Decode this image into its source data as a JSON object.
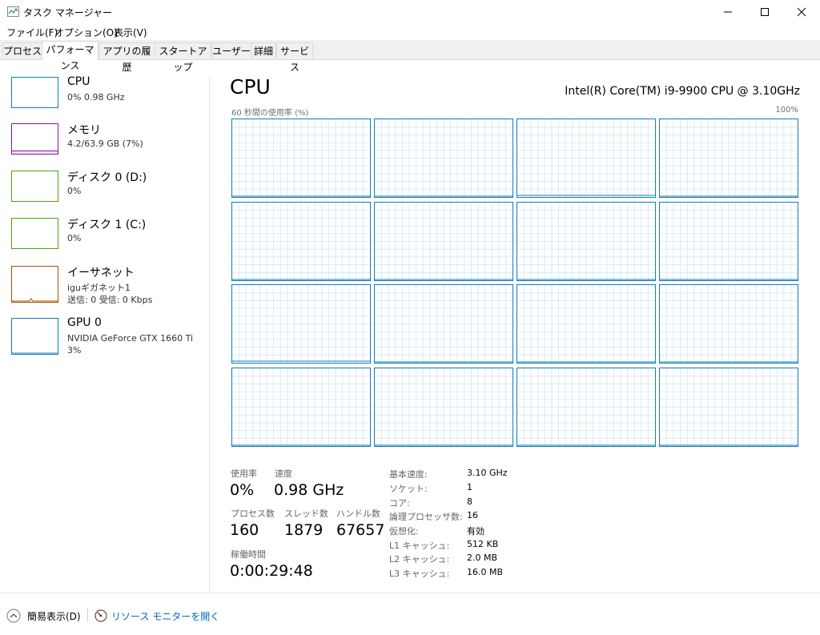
{
  "window": {
    "title": "タスク マネージャー"
  },
  "menu": [
    "ファイル(F)",
    "オプション(O)",
    "表示(V)"
  ],
  "tabs": [
    "プロセス",
    "パフォーマンス",
    "アプリの履歴",
    "スタートアップ",
    "ユーザー",
    "詳細",
    "サービス"
  ],
  "sidebar": [
    {
      "name": "CPU",
      "sub1": "0%  0.98 GHz",
      "sub2": "",
      "sub3": "",
      "color": "#117dbb",
      "icon": "cpu-graph"
    },
    {
      "name": "メモリ",
      "sub1": "4.2/63.9 GB (7%)",
      "sub2": "",
      "sub3": "",
      "color": "#8b12ae",
      "icon": "memory-graph"
    },
    {
      "name": "ディスク 0 (D:)",
      "sub1": "0%",
      "sub2": "",
      "sub3": "",
      "color": "#4da60c",
      "icon": "disk-graph"
    },
    {
      "name": "ディスク 1 (C:)",
      "sub1": "0%",
      "sub2": "",
      "sub3": "",
      "color": "#4da60c",
      "icon": "disk-graph"
    },
    {
      "name": "イーサネット",
      "sub1": "iguギガネット1",
      "sub2": "送信: 0 受信: 0 Kbps",
      "sub3": "",
      "color": "#a74f01",
      "icon": "network-graph"
    },
    {
      "name": "GPU 0",
      "sub1": "NVIDIA GeForce GTX 1660 Ti",
      "sub2": "3%",
      "sub3": "",
      "color": "#117dbb",
      "icon": "gpu-graph"
    }
  ],
  "main": {
    "title": "CPU",
    "model": "Intel(R) Core(TM) i9-9900 CPU @ 3.10GHz",
    "axis_label": "60 秒間の使用率 (%)",
    "axis_max": "100%",
    "accent_color": "#117dbb",
    "grid_color": "#d9eaf4"
  },
  "chart_data": {
    "type": "line",
    "title": "",
    "x_range": [
      0,
      60
    ],
    "ylim": [
      0,
      100
    ],
    "series": [
      {
        "values": [
          0,
          0
        ]
      },
      {
        "values": [
          0,
          0
        ]
      },
      {
        "values": [
          1,
          1,
          1,
          1,
          1,
          1,
          1,
          1,
          1,
          1,
          1,
          1,
          1,
          1,
          1,
          1,
          1,
          1,
          1,
          1,
          1,
          1,
          1,
          1,
          1,
          1,
          1,
          1,
          1,
          1,
          1,
          1,
          1,
          1,
          1,
          1,
          1,
          1,
          1,
          1,
          1,
          1,
          1,
          1,
          1,
          1,
          1,
          1,
          1,
          1,
          1,
          1,
          1,
          1,
          1,
          1,
          1,
          1,
          1,
          1
        ]
      },
      {
        "values": [
          0,
          0
        ]
      },
      {
        "values": [
          0,
          0,
          0,
          0,
          0,
          0,
          0,
          0,
          0,
          0,
          0,
          0,
          0,
          0,
          0,
          0,
          0,
          0,
          0,
          0,
          0,
          0,
          0,
          0,
          0,
          0,
          0,
          0,
          0,
          0,
          0,
          0,
          0,
          0,
          0,
          0,
          0,
          0,
          0,
          0,
          0,
          0,
          0,
          0,
          0,
          0,
          0,
          0,
          0,
          0,
          0,
          0,
          0,
          0,
          0,
          0,
          0,
          0,
          0,
          0
        ]
      },
      {
        "values": [
          0,
          0
        ]
      },
      {
        "values": [
          0,
          0
        ]
      },
      {
        "values": [
          0,
          0
        ]
      },
      {
        "values": [
          1,
          1
        ]
      },
      {
        "values": [
          0,
          0
        ]
      },
      {
        "values": [
          0,
          0
        ]
      },
      {
        "values": [
          0,
          0
        ]
      },
      {
        "values": [
          0,
          0
        ]
      },
      {
        "values": [
          0,
          0
        ]
      },
      {
        "values": [
          0,
          0
        ]
      },
      {
        "values": [
          0,
          0
        ]
      }
    ]
  },
  "stats": {
    "usage_label": "使用率",
    "usage_value": "0%",
    "speed_label": "速度",
    "speed_value": "0.98 GHz",
    "process_label": "プロセス数",
    "process_value": "160",
    "thread_label": "スレッド数",
    "thread_value": "1879",
    "handle_label": "ハンドル数",
    "handle_value": "67657",
    "uptime_label": "稼働時間",
    "uptime_value": "0:00:29:48"
  },
  "specs": [
    {
      "label": "基本速度:",
      "value": "3.10 GHz"
    },
    {
      "label": "ソケット:",
      "value": "1"
    },
    {
      "label": "コア:",
      "value": "8"
    },
    {
      "label": "論理プロセッサ数:",
      "value": "16"
    },
    {
      "label": "仮想化:",
      "value": "有効"
    },
    {
      "label": "L1 キャッシュ:",
      "value": "512 KB"
    },
    {
      "label": "L2 キャッシュ:",
      "value": "2.0 MB"
    },
    {
      "label": "L3 キャッシュ:",
      "value": "16.0 MB"
    }
  ],
  "footer": {
    "fewer_details": "簡易表示(D)",
    "resource_monitor": "リソース モニターを開く",
    "link_color": "#0066cc"
  }
}
